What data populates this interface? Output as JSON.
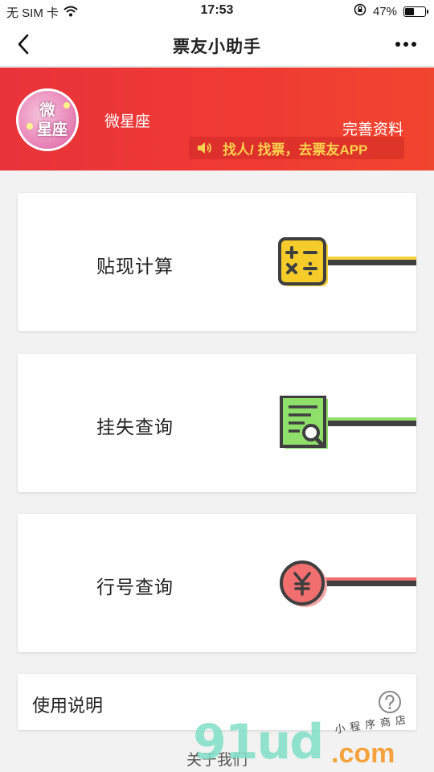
{
  "status_bar": {
    "carrier": "无 SIM 卡",
    "time": "17:53",
    "battery_percent": "47%",
    "battery_level": 0.47
  },
  "nav": {
    "title": "票友小助手"
  },
  "profile": {
    "avatar_text_line1": "微",
    "avatar_text_line2": "星座",
    "name": "微星座",
    "complete_link": "完善资料",
    "notice": "找人/ 找票，去票友APP",
    "notice_color": "#fcd24e",
    "banner_color": "#ec3636"
  },
  "cards": [
    {
      "label": "贴现计算",
      "icon": "calculator-icon",
      "accent": "#f5d23c"
    },
    {
      "label": "挂失查询",
      "icon": "document-search-icon",
      "accent": "#8fe06a"
    },
    {
      "label": "行号查询",
      "icon": "yen-coin-icon",
      "accent": "#f26f6f"
    }
  ],
  "instructions": {
    "label": "使用说明",
    "icon": "help-circle-icon"
  },
  "about": {
    "label": "关于我们"
  },
  "watermark": {
    "main": "91ud",
    "domain": ".com",
    "caption": "小程序商店"
  }
}
